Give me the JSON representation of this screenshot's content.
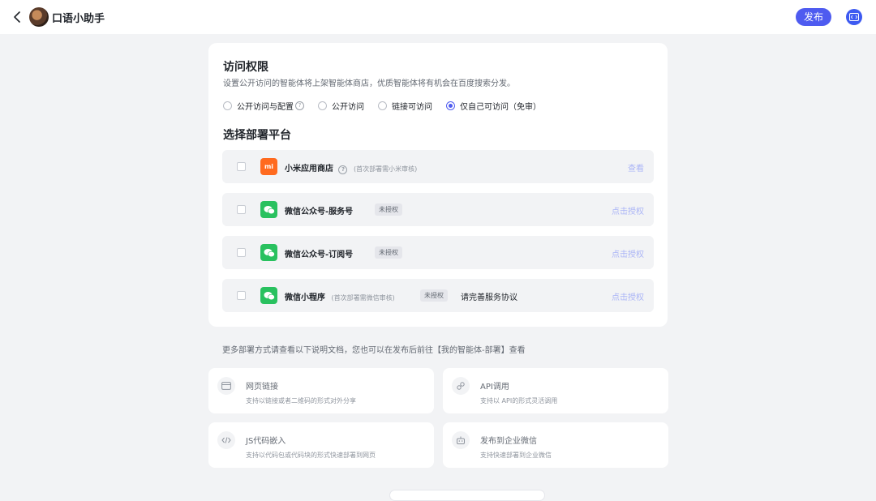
{
  "header": {
    "title": "口语小助手",
    "publish_label": "发布"
  },
  "access": {
    "title": "访问权限",
    "description": "设置公开访问的智能体将上架智能体商店，优质智能体将有机会在百度搜索分发。",
    "options": [
      {
        "label": "公开访问与配置",
        "checked": false,
        "help": true
      },
      {
        "label": "公开访问",
        "checked": false
      },
      {
        "label": "链接可访问",
        "checked": false
      },
      {
        "label": "仅自己可访问（免审）",
        "checked": true
      }
    ]
  },
  "deploy": {
    "title": "选择部署平台",
    "platforms": [
      {
        "name": "小米应用商店",
        "note": "(首次部署需小米审核)",
        "action": "查看",
        "logo": "mi"
      },
      {
        "name": "微信公众号-服务号",
        "badge": "未授权",
        "action": "点击授权",
        "logo": "wechat"
      },
      {
        "name": "微信公众号-订阅号",
        "badge": "未授权",
        "action": "点击授权",
        "logo": "wechat"
      },
      {
        "name": "微信小程序",
        "note": "(首次部署需微信审核)",
        "badge": "未授权",
        "extra": "请完善服务协议",
        "action": "点击授权",
        "logo": "wechat"
      }
    ]
  },
  "more_text": "更多部署方式请查看以下说明文档，您也可以在发布后前往【我的智能体-部署】查看",
  "options": [
    {
      "title": "网页链接",
      "desc": "支持以链接或者二维码的形式对外分享",
      "icon": "card-icon"
    },
    {
      "title": "API调用",
      "desc": "支持以 API的形式灵活调用",
      "icon": "link-icon"
    },
    {
      "title": "JS代码嵌入",
      "desc": "支持以代码包或代码块的形式快速部署到网页",
      "icon": "code-icon"
    },
    {
      "title": "发布到企业微信",
      "desc": "支持快速部署到企业微信",
      "icon": "robot-icon"
    }
  ],
  "colors": {
    "accent": "#4e5bf0",
    "wechat": "#29c15f",
    "xiaomi": "#ff6a1f"
  }
}
